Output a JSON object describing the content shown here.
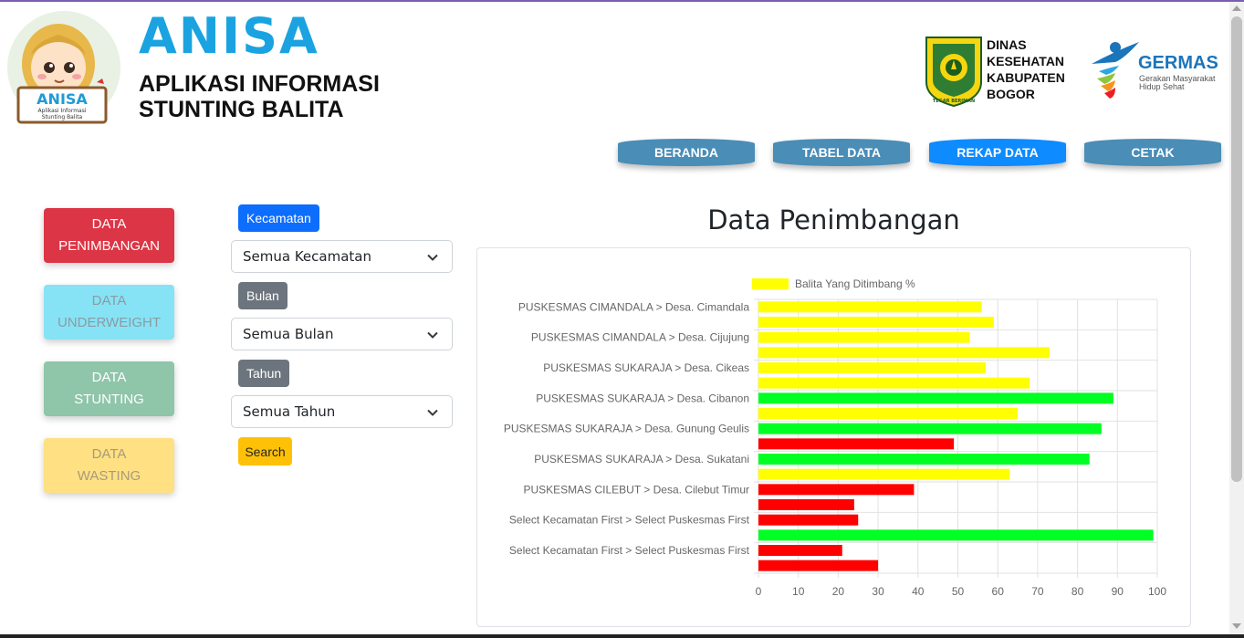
{
  "header": {
    "app_title": "ANISA",
    "app_subtitle_line1": "APLIKASI INFORMASI",
    "app_subtitle_line2": "STUNTING BALITA",
    "mascot_label": "ANISA",
    "mascot_sub1": "Aplikasi Informasi",
    "mascot_sub2": "Stunting Balita",
    "dinas_line1": "DINAS",
    "dinas_line2": "KESEHATAN",
    "dinas_line3": "KABUPATEN",
    "dinas_line4": "BOGOR",
    "dinas_seal_text": "TEGAR BERIMAN",
    "germas_title": "GERMAS",
    "germas_sub1": "Gerakan Masyarakat",
    "germas_sub2": "Hidup Sehat"
  },
  "nav": {
    "items": [
      {
        "label": "BERANDA",
        "active": false
      },
      {
        "label": "TABEL DATA",
        "active": false
      },
      {
        "label": "REKAP DATA",
        "active": true
      },
      {
        "label": "CETAK",
        "active": false
      }
    ]
  },
  "sidebar": {
    "items": [
      {
        "line1": "DATA",
        "line2": "PENIMBANGAN",
        "bg": "#dc3545",
        "fg": "#ffffff"
      },
      {
        "line1": "DATA",
        "line2": "UNDERWEIGHT",
        "bg": "#86e3f5",
        "fg": "#8a9ba3"
      },
      {
        "line1": "DATA",
        "line2": "STUNTING",
        "bg": "#8fc5a9",
        "fg": "#ffffff"
      },
      {
        "line1": "DATA",
        "line2": "WASTING",
        "bg": "#ffe083",
        "fg": "#a79a7a"
      }
    ]
  },
  "filters": {
    "kecamatan_label": "Kecamatan",
    "kecamatan_value": "Semua Kecamatan",
    "bulan_label": "Bulan",
    "bulan_value": "Semua Bulan",
    "tahun_label": "Tahun",
    "tahun_value": "Semua Tahun",
    "search_label": "Search"
  },
  "colors": {
    "primary": "#0d6efd",
    "secondary": "#6c757d",
    "warning": "#ffc107",
    "bar_yellow": "#ffff00",
    "bar_green": "#00ff22",
    "bar_red": "#ff0000"
  },
  "chart_title": "Data Penimbangan",
  "chart_data": {
    "type": "bar",
    "orientation": "horizontal",
    "legend": "Balita Yang Ditimbang %",
    "legend_position": "top",
    "xlim": [
      0,
      100
    ],
    "xticks": [
      0,
      10,
      20,
      30,
      40,
      50,
      60,
      70,
      80,
      90,
      100
    ],
    "grid": true,
    "category_labels": [
      "PUSKESMAS CIMANDALA > Desa. Cimandala",
      "PUSKESMAS CIMANDALA > Desa. Cijujung",
      "PUSKESMAS SUKARAJA > Desa. Cikeas",
      "PUSKESMAS SUKARAJA > Desa. Cibanon",
      "PUSKESMAS SUKARAJA > Desa. Gunung Geulis",
      "PUSKESMAS SUKARAJA > Desa. Sukatani",
      "PUSKESMAS CILEBUT > Desa. Cilebut Timur",
      "Select Kecamatan First > Select Puskesmas First",
      "Select Kecamatan First > Select Puskesmas First"
    ],
    "values": [
      56,
      59,
      53,
      73,
      57,
      68,
      89,
      65,
      86,
      49,
      83,
      63,
      39,
      24,
      25,
      99,
      21,
      30
    ],
    "bar_colors": [
      "yellow",
      "yellow",
      "yellow",
      "yellow",
      "yellow",
      "yellow",
      "green",
      "yellow",
      "green",
      "red",
      "green",
      "yellow",
      "red",
      "red",
      "red",
      "green",
      "red",
      "red"
    ]
  }
}
